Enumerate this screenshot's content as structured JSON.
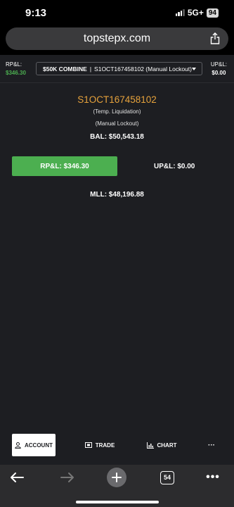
{
  "status": {
    "time": "9:13",
    "network": "5G+",
    "battery": "94"
  },
  "browser": {
    "url": "topstepx.com",
    "tab_count": "54",
    "menu_label": "•••"
  },
  "header": {
    "rpl_label": "RP&L:",
    "rpl_value": "$346.30",
    "upl_label": "UP&L:",
    "upl_value": "$0.00",
    "account_plan": "$50K COMBINE",
    "account_separator": "|",
    "account_name": "S1OCT167458102 (Manual Lockout)"
  },
  "account": {
    "id": "S1OCT167458102",
    "status1": "(Temp. Liquidation)",
    "status2": "(Manual Lockout)",
    "balance": "BAL: $50,543.18",
    "rpl": "RP&L: $346.30",
    "upl": "UP&L: $0.00",
    "mll": "MLL: $48,196.88"
  },
  "nav": {
    "account": "ACCOUNT",
    "trade": "TRADE",
    "chart": "CHART",
    "more": "···"
  },
  "colors": {
    "accent_green": "#4caf50",
    "account_id": "#e6a23c",
    "app_bg": "#1d1e22"
  }
}
